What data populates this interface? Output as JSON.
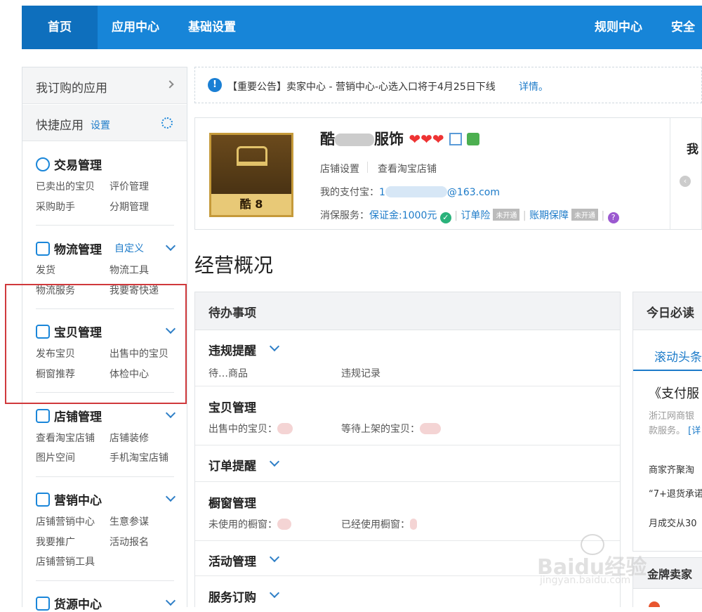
{
  "nav": {
    "home": "首页",
    "app_center": "应用中心",
    "basic_settings": "基础设置",
    "rules_center": "规则中心",
    "security_center": "安全中"
  },
  "sidebar": {
    "subscribed_apps": "我订购的应用",
    "quick_apps": "快捷应用",
    "quick_settings": "设置",
    "sections": [
      {
        "title": "交易管理",
        "links": [
          "已卖出的宝贝",
          "评价管理",
          "采购助手",
          "分期管理"
        ]
      },
      {
        "title": "物流管理",
        "custom": "自定义",
        "links": [
          "发货",
          "物流工具",
          "物流服务",
          "我要寄快递"
        ]
      },
      {
        "title": "宝贝管理",
        "links": [
          "发布宝贝",
          "出售中的宝贝",
          "橱窗推荐",
          "体检中心"
        ]
      },
      {
        "title": "店铺管理",
        "links": [
          "查看淘宝店铺",
          "店铺装修",
          "图片空间",
          "手机淘宝店铺"
        ]
      },
      {
        "title": "营销中心",
        "links": [
          "店铺营销中心",
          "生意参谋",
          "我要推广",
          "活动报名",
          "店铺营销工具"
        ]
      },
      {
        "title": "货源中心"
      }
    ]
  },
  "notice": {
    "text": "【重要公告】卖家中心 - 营销中心-心选入口将于4月25日下线",
    "detail": "详情。"
  },
  "shop": {
    "name_prefix": "酷",
    "name_suffix": "服饰",
    "logo_text": "酷 8",
    "store_settings": "店铺设置",
    "view_store": "查看淘宝店铺",
    "alipay_label": "我的支付宝：",
    "alipay_value": "1",
    "alipay_domain": "@163.com",
    "consumer_label": "消保服务：",
    "deposit": "保证金:1000元",
    "order_insurance": "订单险",
    "not_open": "未开通",
    "account_protection": "账期保障",
    "right_partial": "我"
  },
  "overview_title": "经营概况",
  "todo": {
    "header": "待办事项",
    "rows": [
      {
        "title": "违规提醒",
        "a": "待…商品",
        "b": "违规记录"
      },
      {
        "title": "宝贝管理",
        "a": "出售中的宝贝：",
        "b": "等待上架的宝贝："
      },
      {
        "title": "订单提醒"
      },
      {
        "title": "橱窗管理",
        "a": "未使用的橱窗：",
        "b": "已经使用橱窗："
      },
      {
        "title": "活动管理"
      },
      {
        "title": "服务订购"
      }
    ]
  },
  "today": {
    "header": "今日必读",
    "tab": "滚动头条",
    "headline": "《支付服",
    "line1": "浙江网商银",
    "line2": "款服务。",
    "line2_link": "[详",
    "item1": "商家齐聚淘",
    "item2": "“7+退货承诺",
    "item3": "月成交从30",
    "gold_seller": "金牌卖家"
  },
  "watermark": {
    "brand": "Baidu经验",
    "url": "jingyan.baidu.com"
  }
}
